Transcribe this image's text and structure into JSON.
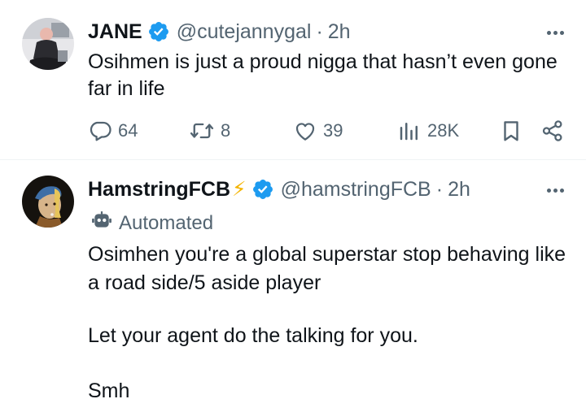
{
  "tweets": [
    {
      "author": {
        "display_name": "JANE",
        "handle": "@cutejannygal",
        "verified": true
      },
      "time": "2h",
      "separator": "·",
      "text": "Osihmen is just a proud nigga that hasn’t even gone far in life",
      "stats": {
        "replies": "64",
        "reposts": "8",
        "likes": "39",
        "views": "28K"
      }
    },
    {
      "author": {
        "display_name": "HamstringFCB",
        "emoji": "⚡",
        "handle": "@hamstringFCB",
        "verified": true
      },
      "time": "2h",
      "separator": "·",
      "automated_label": "Automated",
      "paragraphs": [
        "Osimhen you're a global superstar stop behaving like a road side/5 aside player",
        "Let your agent do the talking for you.",
        "Smh"
      ]
    }
  ],
  "icons": {
    "verified": "verified-badge-icon",
    "more": "more-options-icon",
    "reply": "reply-icon",
    "repost": "repost-icon",
    "like": "like-icon",
    "views": "views-icon",
    "bookmark": "bookmark-icon",
    "share": "share-icon",
    "bot": "bot-icon"
  },
  "colors": {
    "verified": "#1d9bf0",
    "text": "#0f1419",
    "secondary": "#536471",
    "bolt": "#f4b400"
  }
}
